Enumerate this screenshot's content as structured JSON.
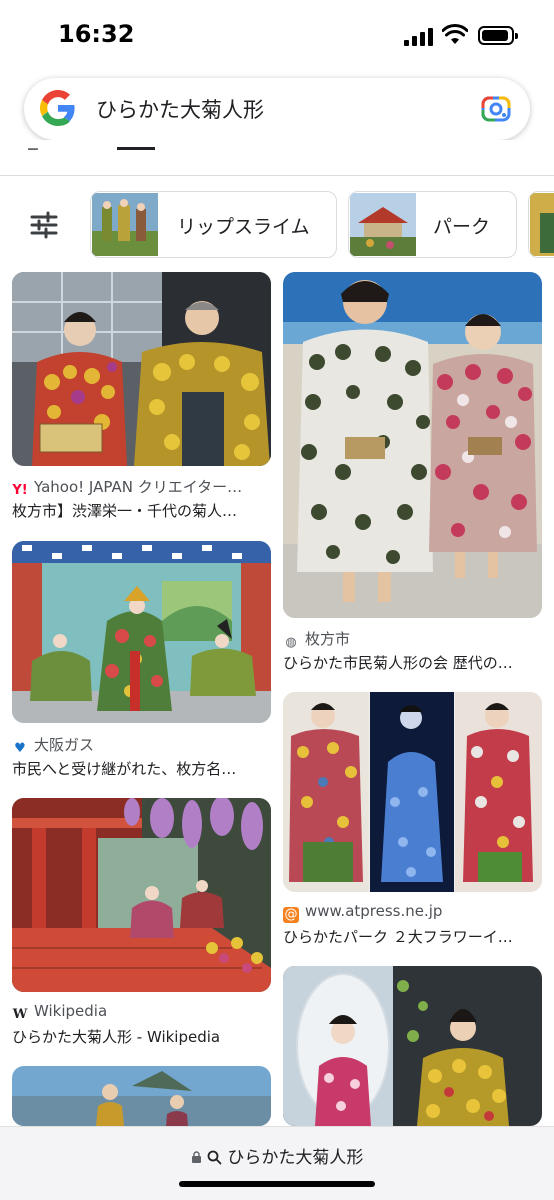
{
  "status_bar": {
    "time": "16:32"
  },
  "search": {
    "query": "ひらかた大菊人形"
  },
  "chips": [
    {
      "label": "リップスライム"
    },
    {
      "label": "パーク"
    }
  ],
  "results": {
    "left": [
      {
        "source": "Yahoo! JAPAN クリエイター…",
        "title": "枚方市】渋澤栄一・千代の菊人…",
        "source_icon": "yahoo-icon"
      },
      {
        "source": "大阪ガス",
        "title": "市民へと受け継がれた、枚方名…",
        "source_icon": "osaka-gas-icon"
      },
      {
        "source": "Wikipedia",
        "title": "ひらかた大菊人形 - Wikipedia",
        "source_icon": "wikipedia-icon"
      }
    ],
    "right": [
      {
        "source": "枚方市",
        "title": "ひらかた市民菊人形の会 歴代の…",
        "source_icon": "globe-icon"
      },
      {
        "source": "www.atpress.ne.jp",
        "title": "ひらかたパーク ２大フラワーイ…",
        "source_icon": "atpress-icon"
      }
    ]
  },
  "bottom_bar": {
    "url_text": "ひらかた大菊人形"
  },
  "colors": {
    "google_blue": "#4285F4",
    "google_red": "#EA4335",
    "google_yellow": "#FBBC05",
    "google_green": "#34A853",
    "yahoo_red": "#ff0033",
    "osaka_gas_blue": "#1a73c9",
    "atpress_orange": "#f5821f"
  }
}
